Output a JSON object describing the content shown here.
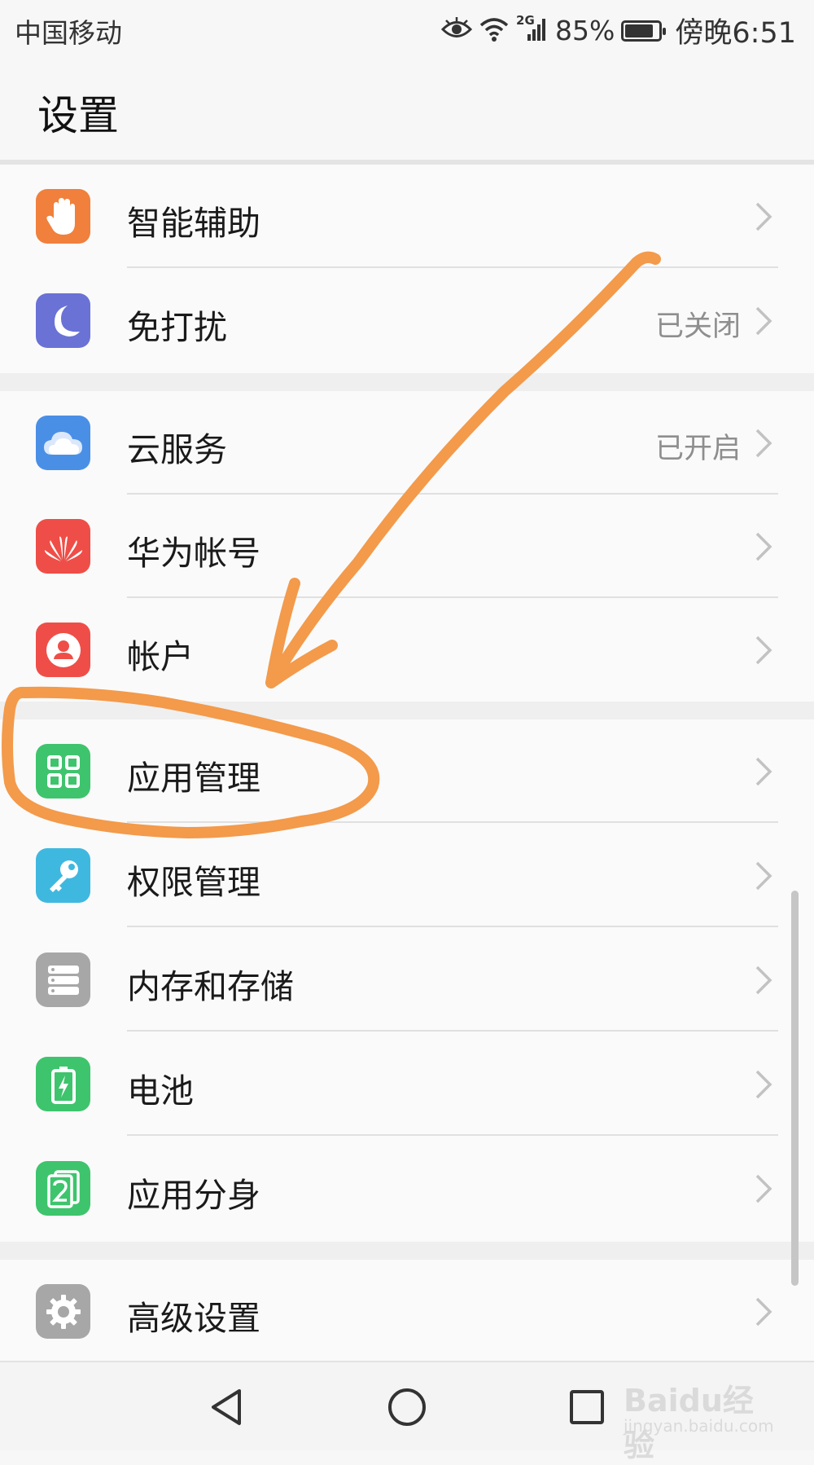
{
  "status_bar": {
    "carrier": "中国移动",
    "network": "2G",
    "battery_percent": "85%",
    "battery_level": 0.85,
    "time": "傍晚6:51",
    "icons": [
      "eye-icon",
      "wifi-icon",
      "cell-signal-icon",
      "battery-icon"
    ]
  },
  "page": {
    "title": "设置"
  },
  "settings": {
    "items": [
      {
        "label": "智能辅助",
        "value": "",
        "icon": "hand-icon",
        "icon_color": "#f0803c"
      },
      {
        "label": "免打扰",
        "value": "已关闭",
        "icon": "moon-icon",
        "icon_color": "#6a72d6"
      },
      {
        "label": "云服务",
        "value": "已开启",
        "icon": "cloud-icon",
        "icon_color": "#4a8fe6"
      },
      {
        "label": "华为帐号",
        "value": "",
        "icon": "huawei-logo-icon",
        "icon_color": "#ef4e48"
      },
      {
        "label": "帐户",
        "value": "",
        "icon": "user-icon",
        "icon_color": "#ef4e48"
      },
      {
        "label": "应用管理",
        "value": "",
        "icon": "app-grid-icon",
        "icon_color": "#3ec46d"
      },
      {
        "label": "权限管理",
        "value": "",
        "icon": "key-icon",
        "icon_color": "#3fb8e0"
      },
      {
        "label": "内存和存储",
        "value": "",
        "icon": "storage-icon",
        "icon_color": "#a7a7a7"
      },
      {
        "label": "电池",
        "value": "",
        "icon": "battery-charge-icon",
        "icon_color": "#3ec46d"
      },
      {
        "label": "应用分身",
        "value": "",
        "icon": "app-twin-icon",
        "icon_color": "#3ec46d"
      },
      {
        "label": "高级设置",
        "value": "",
        "icon": "gear-icon",
        "icon_color": "#a7a7a7"
      }
    ]
  },
  "nav_bar": {
    "icons": [
      "back-icon",
      "home-icon",
      "recents-icon"
    ]
  },
  "annotation": {
    "color": "#f39a4b",
    "highlighted_item": "应用管理"
  },
  "watermark": {
    "brand": "Baidu经验",
    "url": "jingyan.baidu.com"
  }
}
